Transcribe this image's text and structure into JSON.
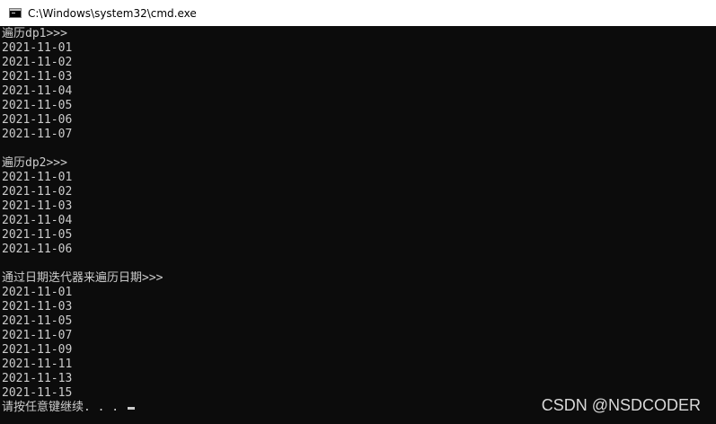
{
  "window": {
    "title": "C:\\Windows\\system32\\cmd.exe",
    "icon": "cmd-icon"
  },
  "console": {
    "lines": [
      "遍历dp1>>>",
      "2021-11-01",
      "2021-11-02",
      "2021-11-03",
      "2021-11-04",
      "2021-11-05",
      "2021-11-06",
      "2021-11-07",
      "",
      "遍历dp2>>>",
      "2021-11-01",
      "2021-11-02",
      "2021-11-03",
      "2021-11-04",
      "2021-11-05",
      "2021-11-06",
      "",
      "通过日期迭代器来遍历日期>>>",
      "2021-11-01",
      "2021-11-03",
      "2021-11-05",
      "2021-11-07",
      "2021-11-09",
      "2021-11-11",
      "2021-11-13",
      "2021-11-15"
    ],
    "prompt": "请按任意键继续. . . "
  },
  "watermark": "CSDN @NSDCODER"
}
